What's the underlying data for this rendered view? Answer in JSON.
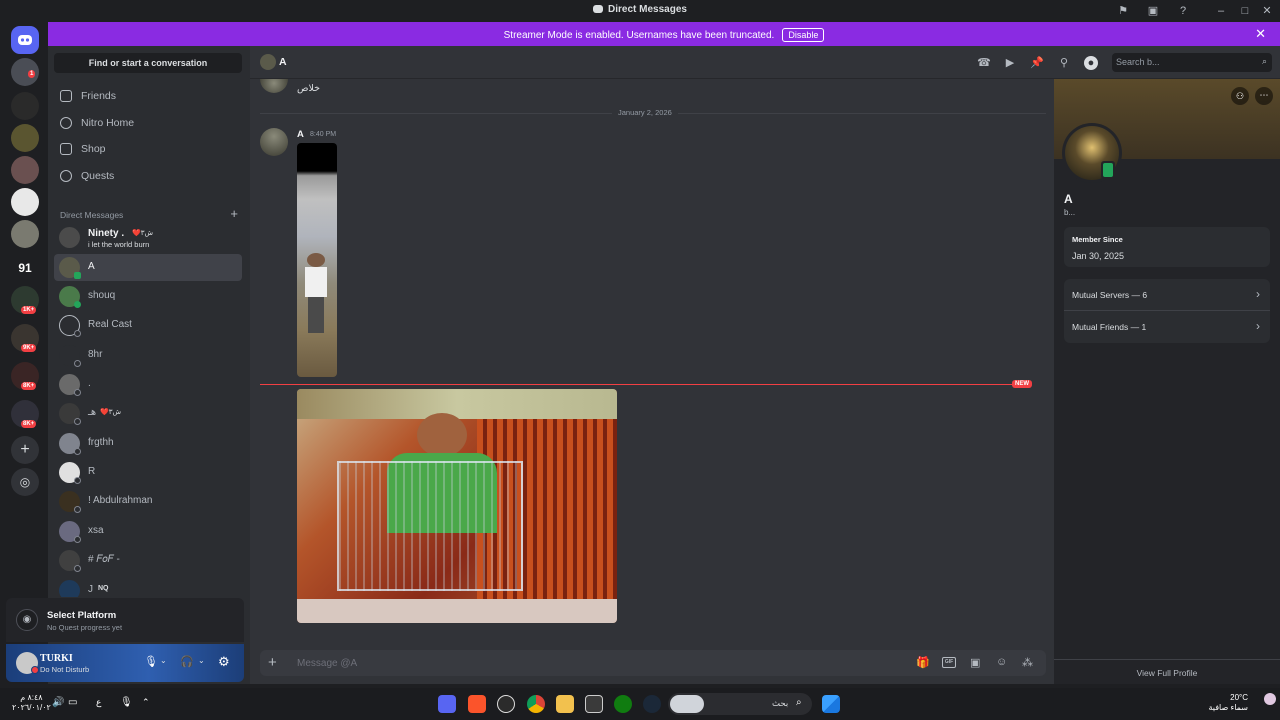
{
  "window": {
    "title": "Direct Messages"
  },
  "banner": {
    "text": "Streamer Mode is enabled. Usernames have been truncated.",
    "disable_label": "Disable"
  },
  "rail": {
    "badges": [
      "1",
      "1K+",
      "9K+",
      "8K+",
      "8K+"
    ],
    "server_text": "91"
  },
  "sidebar": {
    "find_placeholder": "Find or start a conversation",
    "nav": [
      {
        "label": "Friends",
        "icon": "friends-icon"
      },
      {
        "label": "Nitro Home",
        "icon": "nitro-icon"
      },
      {
        "label": "Shop",
        "icon": "shop-icon"
      },
      {
        "label": "Quests",
        "icon": "quests-icon"
      }
    ],
    "dm_header": "Direct Messages",
    "dms": [
      {
        "name": "Ninety .",
        "sub": "i let the world burn",
        "tag": "❤️ش٣"
      },
      {
        "name": "A",
        "selected": true
      },
      {
        "name": "shouq"
      },
      {
        "name": "Real Cast"
      },
      {
        "name": "8hr"
      },
      {
        "name": "."
      },
      {
        "name": "هـ",
        "tag": "❤️ش٣"
      },
      {
        "name": "frgthh"
      },
      {
        "name": "R"
      },
      {
        "name": "! Abdulrahman"
      },
      {
        "name": "xsa"
      },
      {
        "name": "# 𝐹𝑜𝐹 -"
      },
      {
        "name": "J",
        "tag": "NQ"
      }
    ]
  },
  "quest": {
    "title": "Select Platform",
    "sub": "No Quest progress yet"
  },
  "user": {
    "name": "TURKI",
    "status": "Do Not Disturb"
  },
  "chat": {
    "recipient": "A",
    "prev_text": "خلاص",
    "date_divider": "January 2, 2026",
    "message_author": "A",
    "message_time": "8:40 PM",
    "new_label": "NEW",
    "composer_placeholder": "Message @A",
    "search_placeholder": "Search b..."
  },
  "profile": {
    "name": "A",
    "sub": "b...",
    "member_since_label": "Member Since",
    "member_since": "Jan 30, 2025",
    "mutual_servers": "Mutual Servers — 6",
    "mutual_friends": "Mutual Friends — 1",
    "view_full": "View Full Profile"
  },
  "taskbar": {
    "time": "٨:٤٨ م",
    "date": "٢٠٢٦/٠١/٠٢",
    "lang": "ع",
    "search": "بحث",
    "temp": "20°C",
    "weather": "سماء صافية"
  },
  "colors": {
    "banner": "#8a2be2",
    "accent": "#5865f2",
    "danger": "#f23f43",
    "online": "#23a55a"
  }
}
